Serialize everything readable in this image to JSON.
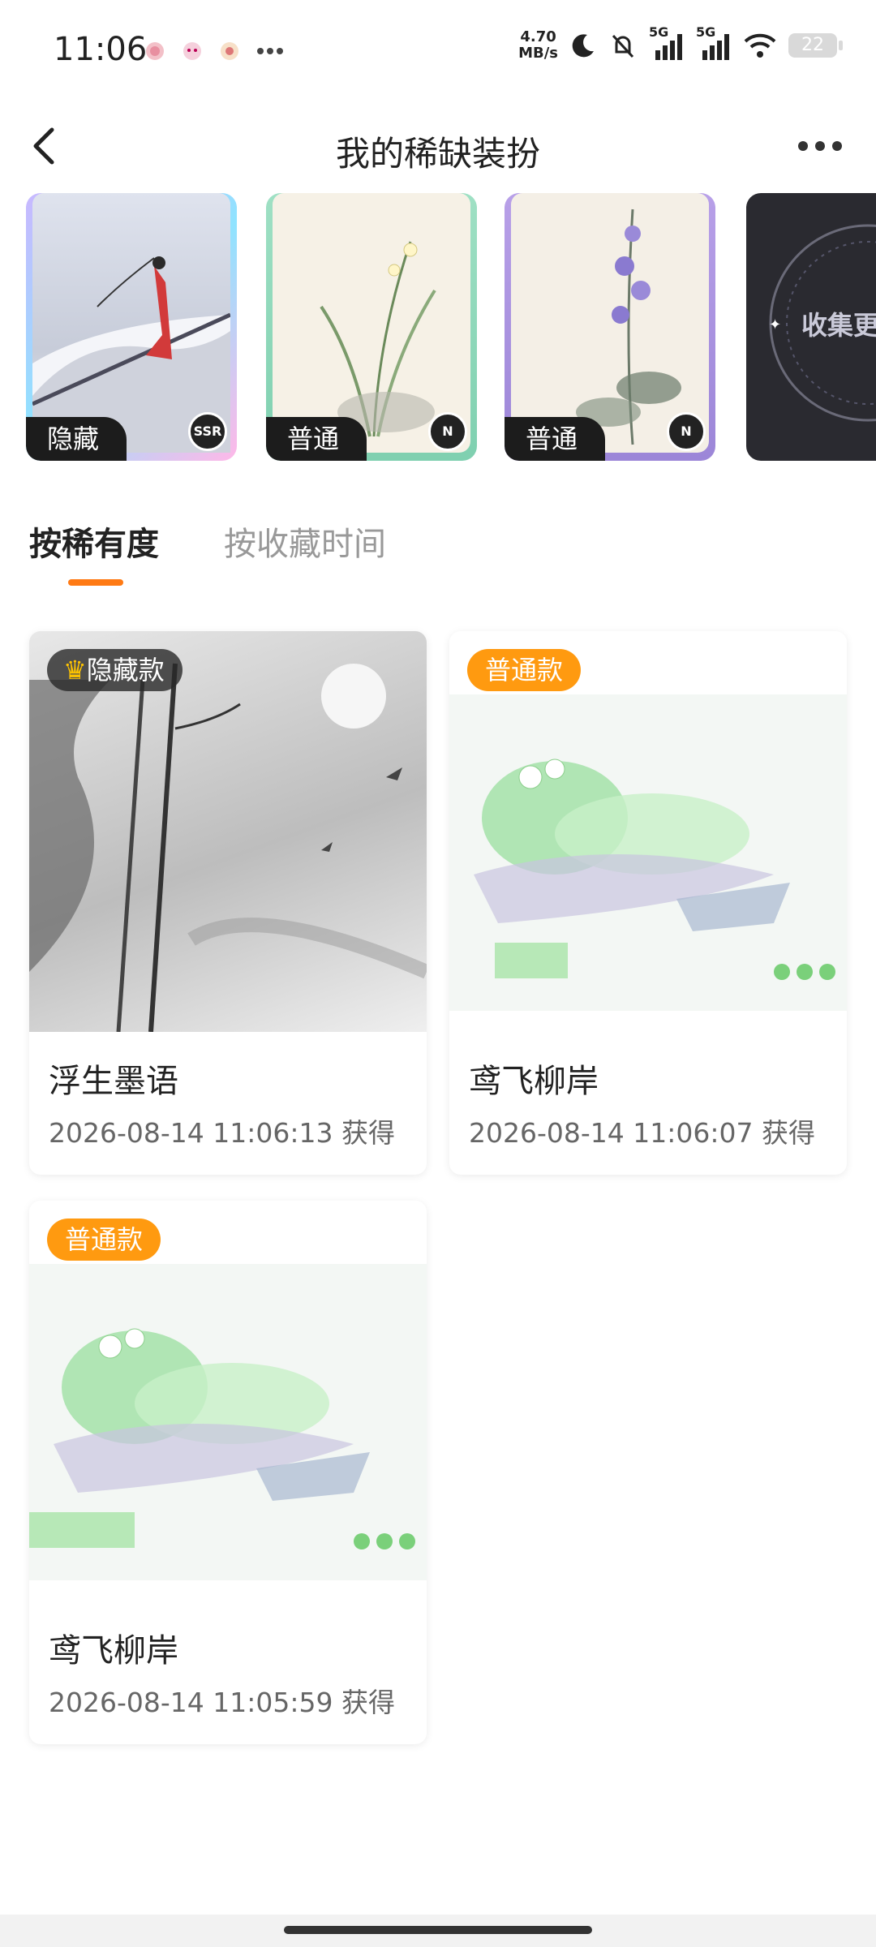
{
  "status_bar": {
    "time": "11:06",
    "speed_value": "4.70",
    "speed_unit": "MB/s",
    "signal_label_1": "5G",
    "signal_label_2": "5G",
    "battery": "22"
  },
  "header": {
    "title": "我的稀缺装扮"
  },
  "carousel": {
    "items": [
      {
        "tag": "隐藏",
        "rank": "SSR"
      },
      {
        "tag": "普通",
        "rank": "N"
      },
      {
        "tag": "普通",
        "rank": "N"
      },
      {
        "label": "收集更"
      }
    ]
  },
  "sort_tabs": [
    {
      "label": "按稀有度",
      "active": true
    },
    {
      "label": "按收藏时间",
      "active": false
    }
  ],
  "items": [
    {
      "badge": "隐藏款",
      "name": "浮生墨语",
      "date": "2026-08-14 11:06:13 获得"
    },
    {
      "badge": "普通款",
      "name": "鸢飞柳岸",
      "date": "2026-08-14 11:06:07 获得"
    },
    {
      "badge": "普通款",
      "name": "鸢飞柳岸",
      "date": "2026-08-14 11:05:59 获得"
    }
  ],
  "colors": {
    "accent": "#ff7a14",
    "badge_normal": "#ff9a10"
  }
}
